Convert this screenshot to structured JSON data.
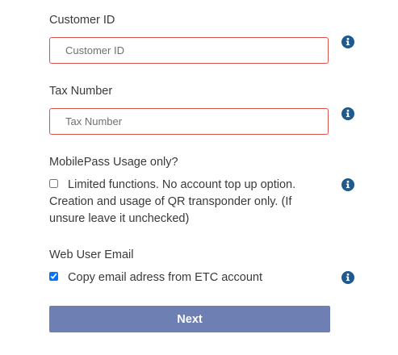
{
  "customer_id": {
    "label": "Customer ID",
    "placeholder": "Customer ID",
    "value": ""
  },
  "tax_number": {
    "label": "Tax Number",
    "placeholder": "Tax Number",
    "value": ""
  },
  "mobilepass": {
    "label": "MobilePass Usage only?",
    "checkbox_text": "Limited functions. No account top up option. Creation and usage of QR transponder only. (If unsure leave it unchecked)",
    "checked": false
  },
  "web_user_email": {
    "label": "Web User Email",
    "checkbox_text": "Copy email adress from ETC account",
    "checked": true
  },
  "next_button": {
    "label": "Next"
  },
  "colors": {
    "error_border": "#d9534f",
    "info_icon": "#1f5a8f",
    "button_bg": "#6e7fb4"
  },
  "icons": {
    "info": "info-circle-icon"
  }
}
